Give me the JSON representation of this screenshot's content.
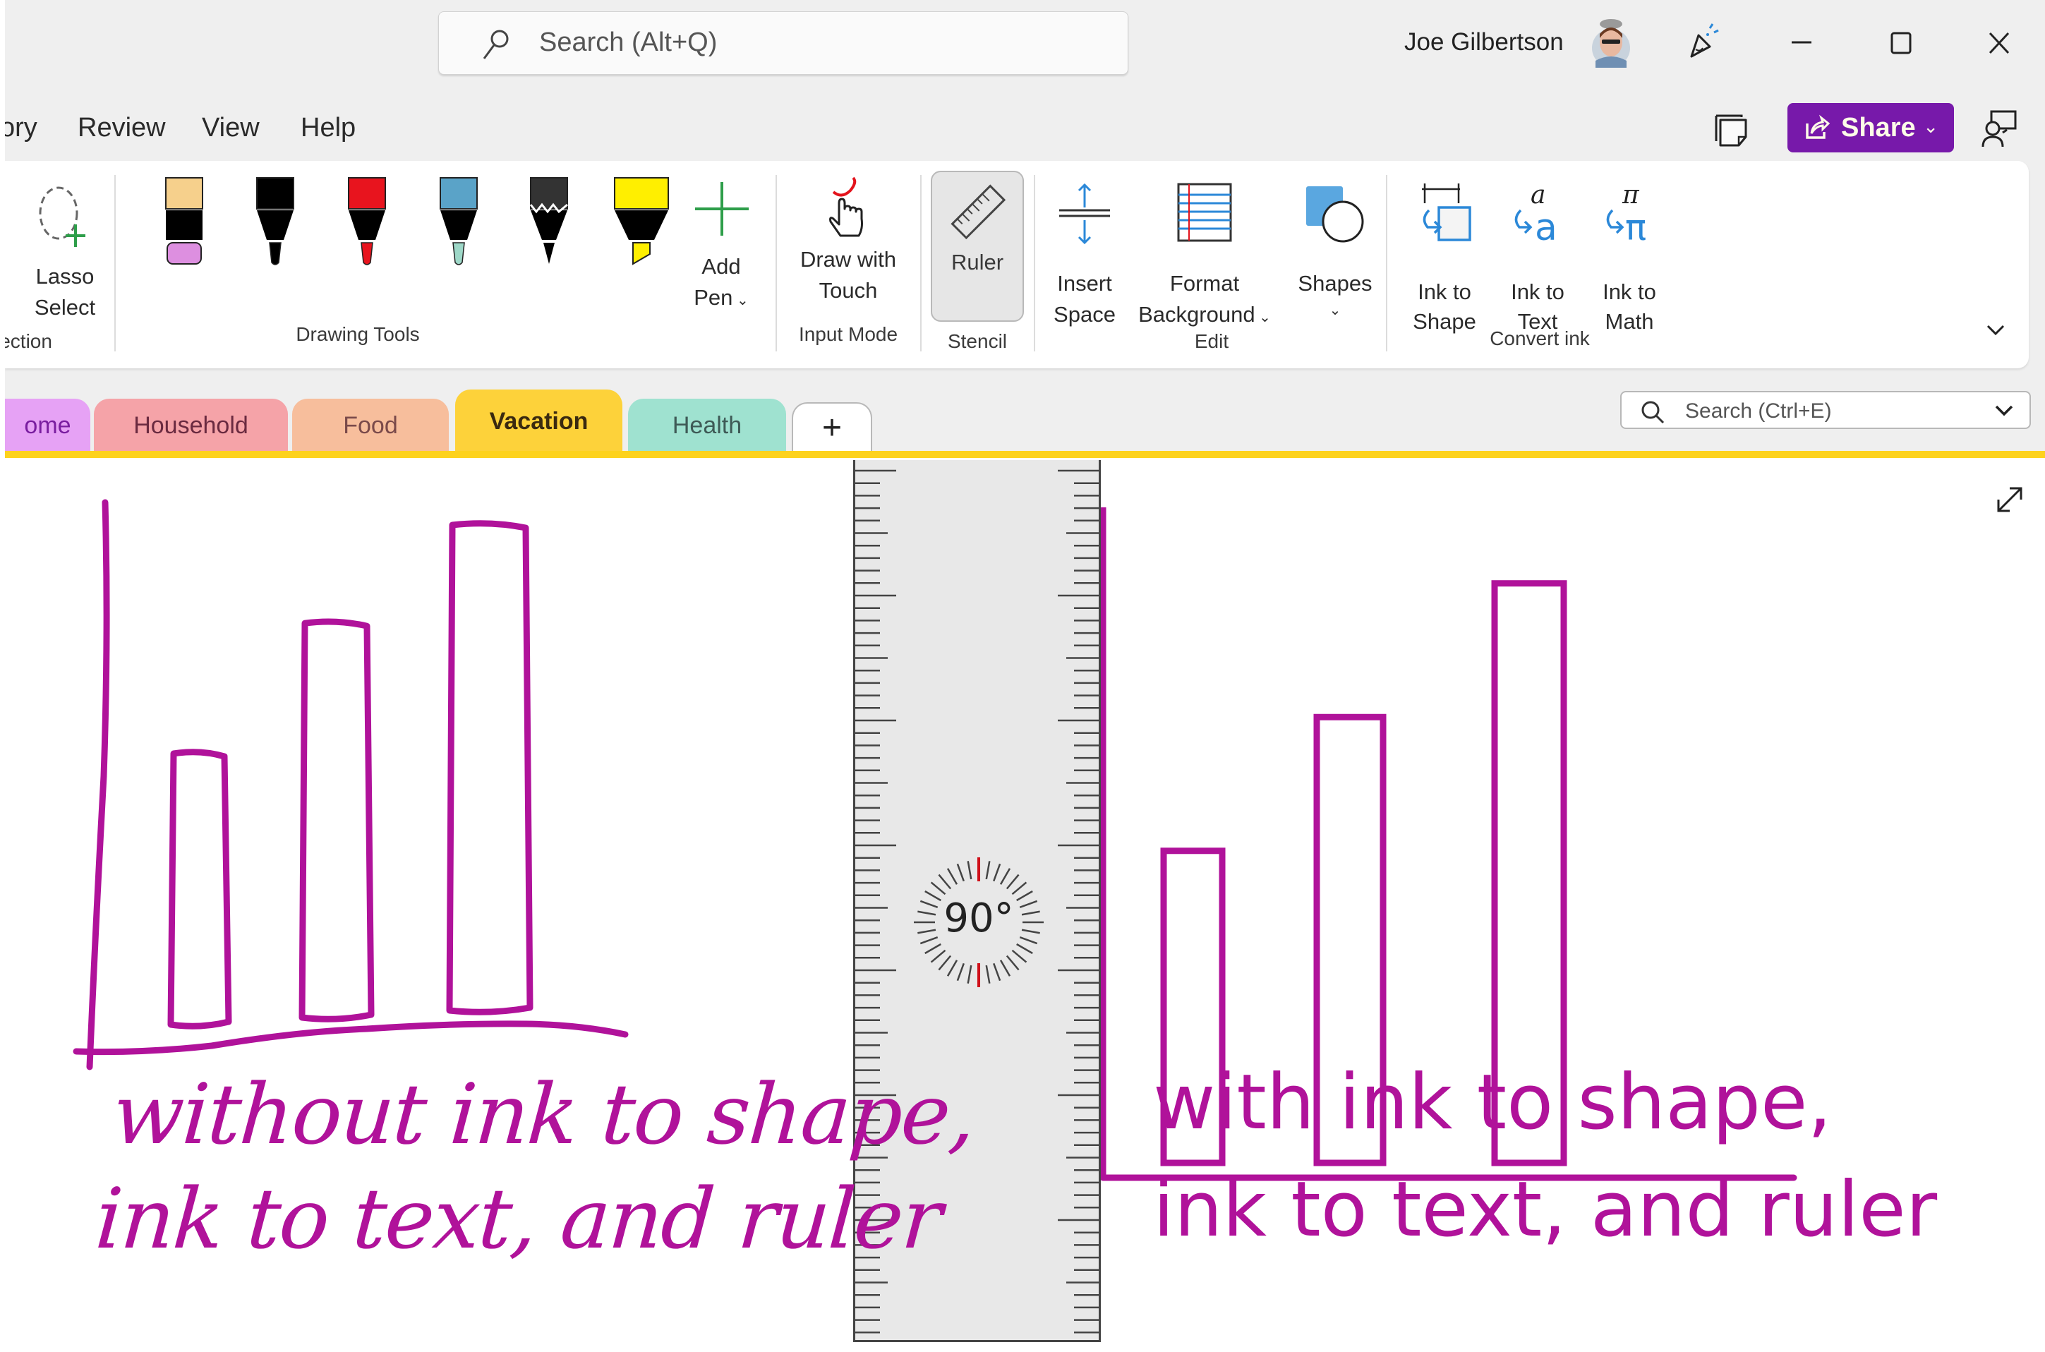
{
  "titlebar": {
    "search_placeholder": "Search (Alt+Q)",
    "user_name": "Joe Gilbertson",
    "icons": [
      "search-icon",
      "avatar",
      "celebrate-icon",
      "minimize-icon",
      "maximize-icon",
      "close-icon"
    ]
  },
  "menu": {
    "items": [
      "ory",
      "Review",
      "View",
      "Help"
    ],
    "share_label": "Share",
    "icons": [
      "sticky-note-icon",
      "share-icon",
      "chevron-down-icon",
      "present-person-icon"
    ]
  },
  "ribbon": {
    "lasso": {
      "line1": "Lasso",
      "line2": "Select",
      "group": "lection"
    },
    "drawing_tools": {
      "group": "Drawing Tools",
      "pens": [
        {
          "name": "eraser",
          "body": "#f6d08c",
          "tip": "#dd8fe0"
        },
        {
          "name": "black-pen",
          "body": "#000000",
          "tip": "#000000"
        },
        {
          "name": "red-pen",
          "body": "#e8141e",
          "tip": "#e8141e"
        },
        {
          "name": "galaxy-pen",
          "body": "#5aa3c8",
          "tip": "#9ed8c8"
        },
        {
          "name": "pencil",
          "body": "#333333",
          "tip": "#111111"
        },
        {
          "name": "highlighter",
          "body": "#ffef00",
          "tip": "#ffef00"
        }
      ],
      "add_pen": {
        "line1": "Add",
        "line2": "Pen"
      }
    },
    "input_mode": {
      "line1": "Draw with",
      "line2": "Touch",
      "group": "Input Mode"
    },
    "stencil": {
      "label": "Ruler",
      "group": "Stencil",
      "active": true
    },
    "edit": {
      "group": "Edit",
      "insert_space": {
        "line1": "Insert",
        "line2": "Space"
      },
      "format_background": {
        "line1": "Format",
        "line2": "Background"
      },
      "shapes": {
        "line1": "Shapes"
      }
    },
    "convert_ink": {
      "group": "Convert ink",
      "ink_to_shape": {
        "line1": "Ink to",
        "line2": "Shape"
      },
      "ink_to_text": {
        "line1": "Ink to",
        "line2": "Text"
      },
      "ink_to_math": {
        "line1": "Ink to",
        "line2": "Math"
      }
    }
  },
  "sections": {
    "tabs": [
      {
        "label": "ome",
        "bg": "#e6a2f5",
        "fg": "#7a1ea0"
      },
      {
        "label": "Household",
        "bg": "#f5a3a8",
        "fg": "#6a2a40"
      },
      {
        "label": "Food",
        "bg": "#f7be9c",
        "fg": "#7a4a4a"
      },
      {
        "label": "Vacation",
        "bg": "#fdd23a",
        "fg": "#3a2a10",
        "active": true
      },
      {
        "label": "Health",
        "bg": "#9fe2d0",
        "fg": "#3e5a56"
      }
    ],
    "add_label": "+",
    "search_placeholder": "Search (Ctrl+E)"
  },
  "canvas": {
    "ink_color": "#b0129a",
    "ruler_angle": "90°",
    "left_caption": [
      "without ink to shape,",
      "ink to text, and ruler"
    ],
    "right_caption": [
      "with ink to shape,",
      "ink to text, and ruler"
    ],
    "left_chart": {
      "bars_relative": [
        0.5,
        0.73,
        0.9
      ]
    },
    "right_chart": {
      "bars_relative": [
        0.49,
        0.7,
        0.91
      ]
    }
  }
}
